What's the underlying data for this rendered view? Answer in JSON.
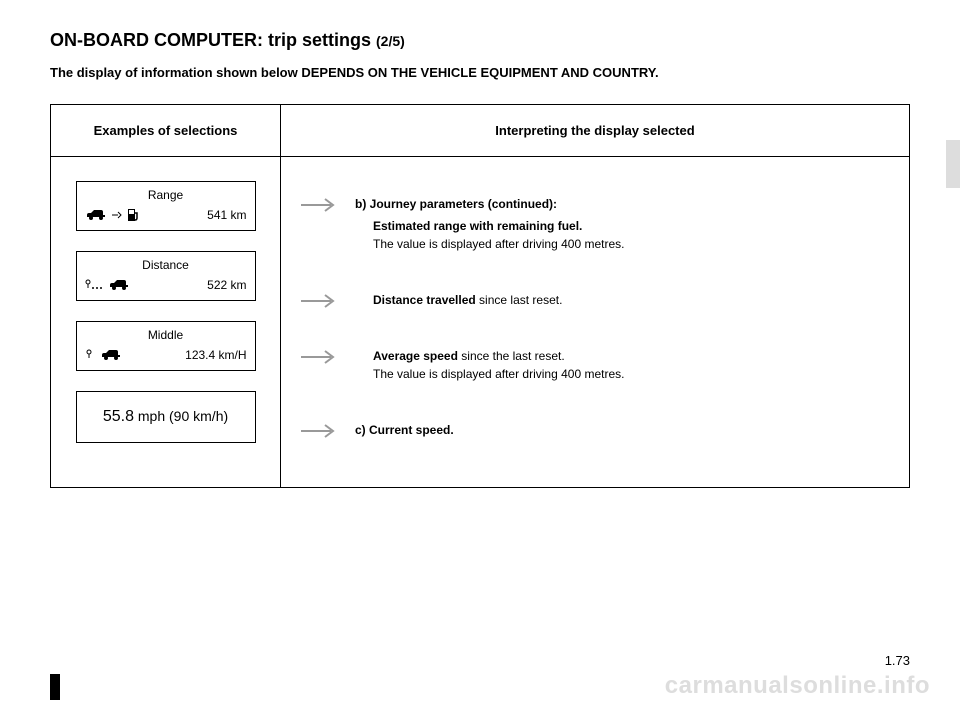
{
  "header": {
    "title_main": "ON-BOARD COMPUTER: trip settings ",
    "title_sub": "(2/5)",
    "notice": "The display of information shown below DEPENDS ON THE VEHICLE EQUIPMENT AND COUNTRY."
  },
  "table": {
    "col1": "Examples of selections",
    "col2": "Interpreting the display selected"
  },
  "rows": {
    "range": {
      "label": "Range",
      "value": "541 km",
      "lead": "b) Journey parameters (continued):",
      "bold": "Estimated range with remaining fuel.",
      "detail": "The value is displayed after driving 400 metres."
    },
    "distance": {
      "label": "Distance",
      "value": "522 km",
      "bold": "Distance travelled",
      "rest": " since last reset."
    },
    "middle": {
      "label": "Middle",
      "value": "123.4 km/H",
      "bold": "Average speed",
      "rest": " since the last reset.",
      "detail": "The value is displayed after driving 400 metres."
    },
    "speed": {
      "big": "55.8",
      "unit": " mph (90 km/h)",
      "lead": "c) Current speed."
    }
  },
  "page_number": "1.73",
  "watermark": "carmanualsonline.info"
}
